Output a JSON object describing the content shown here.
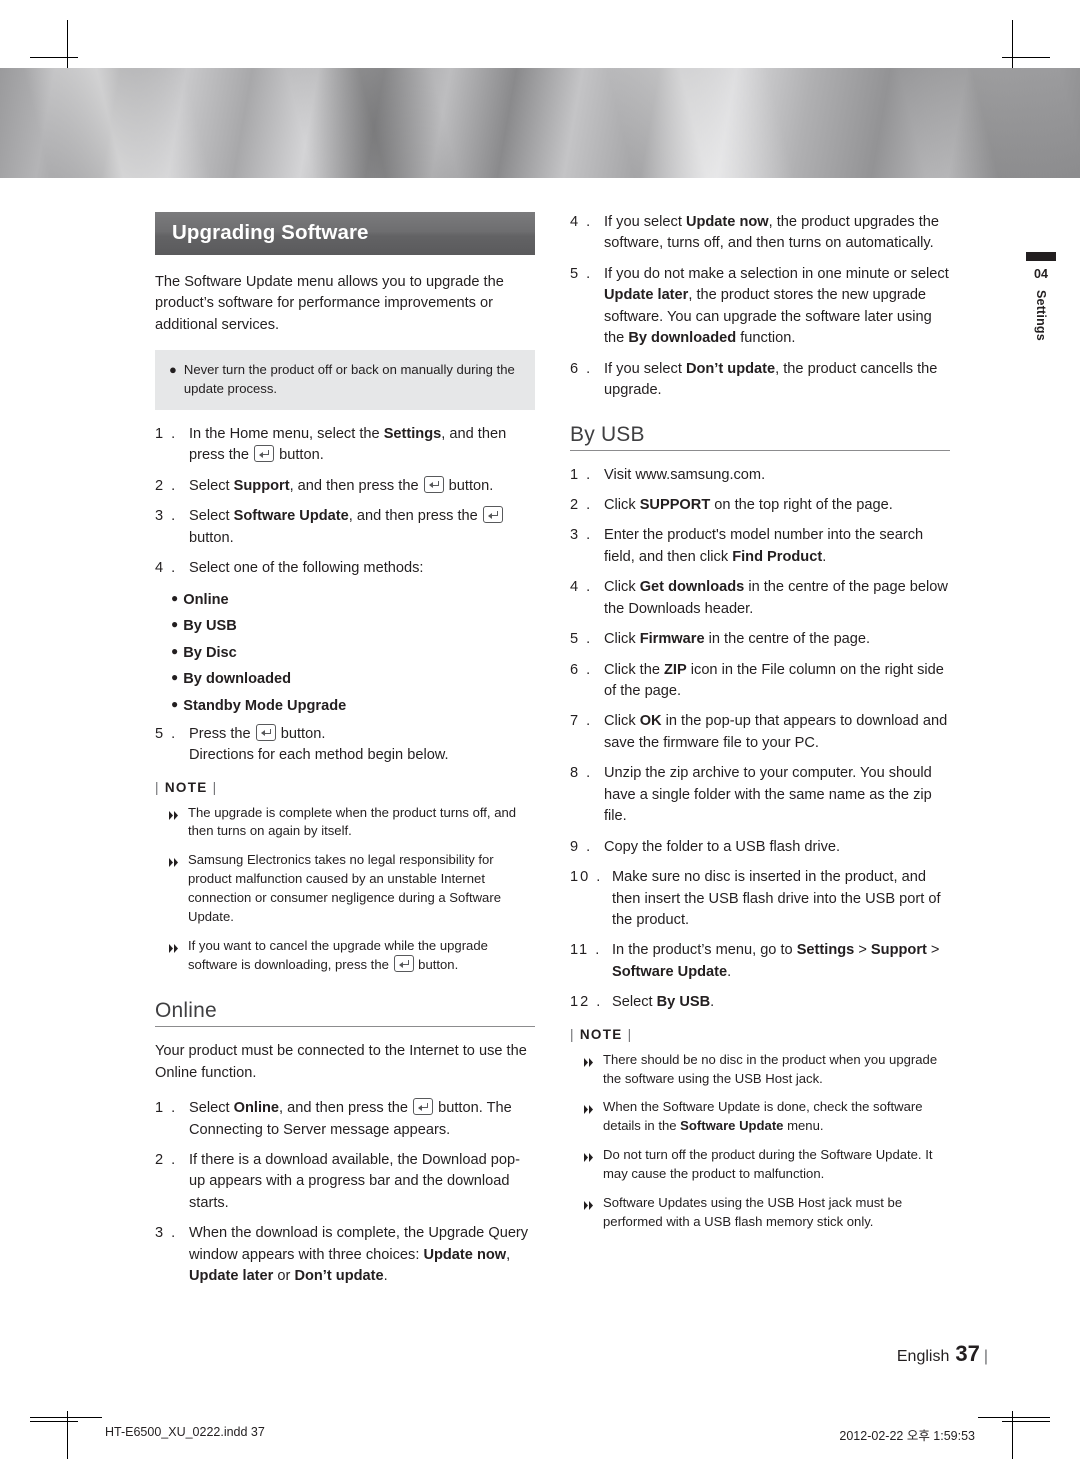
{
  "page": {
    "side_tab": {
      "number": "04",
      "label": "Settings"
    },
    "footer": {
      "language": "English",
      "page_number": "37",
      "file_name": "HT-E6500_XU_0222.indd   37",
      "timestamp": "2012-02-22   오후 1:59:53"
    }
  },
  "left": {
    "title": "Upgrading Software",
    "intro": "The Software Update menu allows you to upgrade the product’s software for performance improvements or additional services.",
    "caution": "Never turn the product off or back on manually during the update process.",
    "steps": [
      {
        "num": "1 .",
        "text_pre": "In the Home menu, select the ",
        "bold1": "Settings",
        "text_mid": ", and then press the ",
        "icon": "enter-key-icon",
        "text_post": " button."
      },
      {
        "num": "2 .",
        "text_pre": "Select ",
        "bold1": "Support",
        "text_mid": ", and then press the ",
        "icon": "enter-key-icon",
        "text_post": " button."
      },
      {
        "num": "3 .",
        "text_pre": "Select ",
        "bold1": "Software Update",
        "text_mid": ", and then press the ",
        "icon": "enter-key-icon",
        "text_post": " button."
      },
      {
        "num": "4 .",
        "text_pre": "Select one of the following methods:"
      }
    ],
    "methods": [
      "Online",
      "By USB",
      "By Disc",
      "By downloaded",
      "Standby Mode Upgrade"
    ],
    "step5": {
      "num": "5 .",
      "text_pre": "Press the ",
      "icon": "enter-key-icon",
      "text_post": " button.",
      "text_line2": "Directions for each method begin below."
    },
    "note_label": "NOTE",
    "notes": [
      "The upgrade is complete when the product turns off, and then turns on again by itself.",
      "Samsung Electronics takes no legal responsibility for product malfunction caused by an unstable Internet connection or consumer negligence during a Software Update.",
      "If you want to cancel the upgrade while the upgrade software is downloading, press the ■ button."
    ],
    "note3": {
      "pre": "If you want to cancel the upgrade while the upgrade software is downloading, press the ",
      "post": " button."
    },
    "online": {
      "heading": "Online",
      "intro": "Your product must be connected to the Internet to use the Online function.",
      "steps": [
        {
          "num": "1 .",
          "pre": "Select ",
          "b1": "Online",
          "mid": ", and then press the ",
          "post": " button. The Connecting to Server message appears."
        },
        {
          "num": "2 .",
          "plain": "If there is a download available, the Download pop-up appears with a progress bar and the download starts."
        },
        {
          "num": "3 .",
          "pre": "When the download is complete, the Upgrade Query window appears with three choices: ",
          "b1": "Update now",
          "sep1": ", ",
          "b2": "Update later",
          "sep2": " or ",
          "b3": "Don’t update",
          "end": "."
        }
      ]
    }
  },
  "right": {
    "steps_top": [
      {
        "num": "4 .",
        "pre": "If you select ",
        "b1": "Update now",
        "post": ", the product upgrades the software, turns off, and then turns on automatically."
      },
      {
        "num": "5 .",
        "pre": "If you do not make a selection in one minute or select ",
        "b1": "Update later",
        "mid": ", the product stores the new upgrade software. You can upgrade the software later using the ",
        "b2": "By downloaded",
        "post": " function."
      },
      {
        "num": "6 .",
        "pre": "If you select ",
        "b1": "Don’t update",
        "post": ", the product cancells the upgrade."
      }
    ],
    "byusb": {
      "heading": "By USB",
      "steps": [
        {
          "num": "1 .",
          "plain": "Visit www.samsung.com."
        },
        {
          "num": "2 .",
          "pre": "Click ",
          "b1": "SUPPORT",
          "post": " on the top right of the page."
        },
        {
          "num": "3 .",
          "pre": "Enter the product's model number into the search field, and then click ",
          "b1": "Find Product",
          "post": "."
        },
        {
          "num": "4 .",
          "pre": "Click ",
          "b1": "Get downloads",
          "post": " in the centre of the page below the Downloads header."
        },
        {
          "num": "5 .",
          "pre": "Click ",
          "b1": "Firmware",
          "post": " in the centre of the page."
        },
        {
          "num": "6 .",
          "pre": "Click the ",
          "b1": "ZIP",
          "post": " icon in the File column on the right side of the page."
        },
        {
          "num": "7 .",
          "pre": "Click ",
          "b1": "OK",
          "post": " in the pop-up that appears to download and save the firmware file to your PC."
        },
        {
          "num": "8 .",
          "plain": "Unzip the zip archive to your computer. You should have a single folder with the same name as the zip file."
        },
        {
          "num": "9 .",
          "plain": "Copy the folder to a USB flash drive."
        },
        {
          "num": "10 .",
          "plain": "Make sure no disc is inserted in the product, and then insert the USB flash drive into the USB port of the product."
        },
        {
          "num": "11 .",
          "pre": "In the product’s menu, go to ",
          "b1": "Settings",
          "mid": " > ",
          "b2": "Support",
          "mid2": " > ",
          "b3": "Software Update",
          "post": "."
        },
        {
          "num": "12 .",
          "pre": "Select ",
          "b1": "By USB",
          "post": "."
        }
      ]
    },
    "note_label": "NOTE",
    "notes": [
      {
        "plain": "There should be no disc in the product when you upgrade the software using the USB Host jack."
      },
      {
        "pre": "When the Software Update is done, check the software details in the ",
        "b1": "Software Update",
        "post": " menu."
      },
      {
        "plain": "Do not turn off the product during the Software Update. It may cause the product to malfunction."
      },
      {
        "plain": "Software Updates using the USB Host jack must be performed with a USB flash memory stick only."
      }
    ]
  }
}
